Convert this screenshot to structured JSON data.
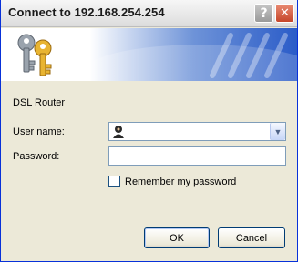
{
  "window": {
    "title": "Connect to 192.168.254.254",
    "help_glyph": "?",
    "close_glyph": "✕",
    "icons": [
      "keys-icon",
      "help-icon",
      "close-icon",
      "user-icon",
      "chevron-down-icon"
    ]
  },
  "site_label": "DSL Router",
  "form": {
    "user_label": "User name:",
    "user_value": "",
    "password_label": "Password:",
    "password_value": "",
    "remember_label": "Remember my password",
    "remember_checked": false
  },
  "buttons": {
    "ok": "OK",
    "cancel": "Cancel"
  },
  "colors": {
    "dialog_bg": "#ece9d8",
    "banner_blue": "#2b5cc8",
    "field_border": "#7f9db9"
  }
}
